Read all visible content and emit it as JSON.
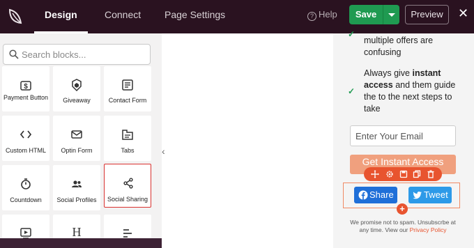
{
  "topbar": {
    "tabs": [
      {
        "label": "Design"
      },
      {
        "label": "Connect"
      },
      {
        "label": "Page Settings"
      }
    ],
    "help_label": "Help",
    "save_label": "Save",
    "preview_label": "Preview",
    "close_glyph": "✕"
  },
  "sidebar": {
    "search_placeholder": "Search blocks...",
    "blocks": [
      {
        "label": "Payment Button",
        "icon": "dollar-icon"
      },
      {
        "label": "Giveaway",
        "icon": "giveaway-icon"
      },
      {
        "label": "Contact Form",
        "icon": "contact-form-icon"
      },
      {
        "label": "Custom HTML",
        "icon": "code-icon"
      },
      {
        "label": "Optin Form",
        "icon": "envelope-icon"
      },
      {
        "label": "Tabs",
        "icon": "tabs-icon"
      },
      {
        "label": "Countdown",
        "icon": "stopwatch-icon"
      },
      {
        "label": "Social Profiles",
        "icon": "people-icon"
      },
      {
        "label": "Social Sharing",
        "icon": "share-icon",
        "selected": true
      },
      {
        "label": "",
        "icon": "video-icon"
      },
      {
        "label": "",
        "icon": "heading-icon"
      },
      {
        "label": "",
        "icon": "align-icon"
      }
    ]
  },
  "canvas": {
    "bullet_1_tail": "multiple offers are confusing",
    "bullet_2_pre": "Always give ",
    "bullet_2_bold": "instant access",
    "bullet_2_post": " and them guide the to the next steps to take",
    "email_placeholder": "Enter Your Email",
    "cta_label": "Get Instant Access",
    "share_label": "Share",
    "tweet_label": "Tweet",
    "disclaimer_text": "We promise not to spam. Unsubscrbe at any time. View our ",
    "privacy_link": "Privacy Policy"
  },
  "colors": {
    "topbar_bg": "#2a1220",
    "save_green": "#1f9a51",
    "accent_orange": "#e8542f",
    "facebook_blue": "#1f6fd8",
    "twitter_blue": "#2d9ae8",
    "selected_red": "#d9312f"
  }
}
